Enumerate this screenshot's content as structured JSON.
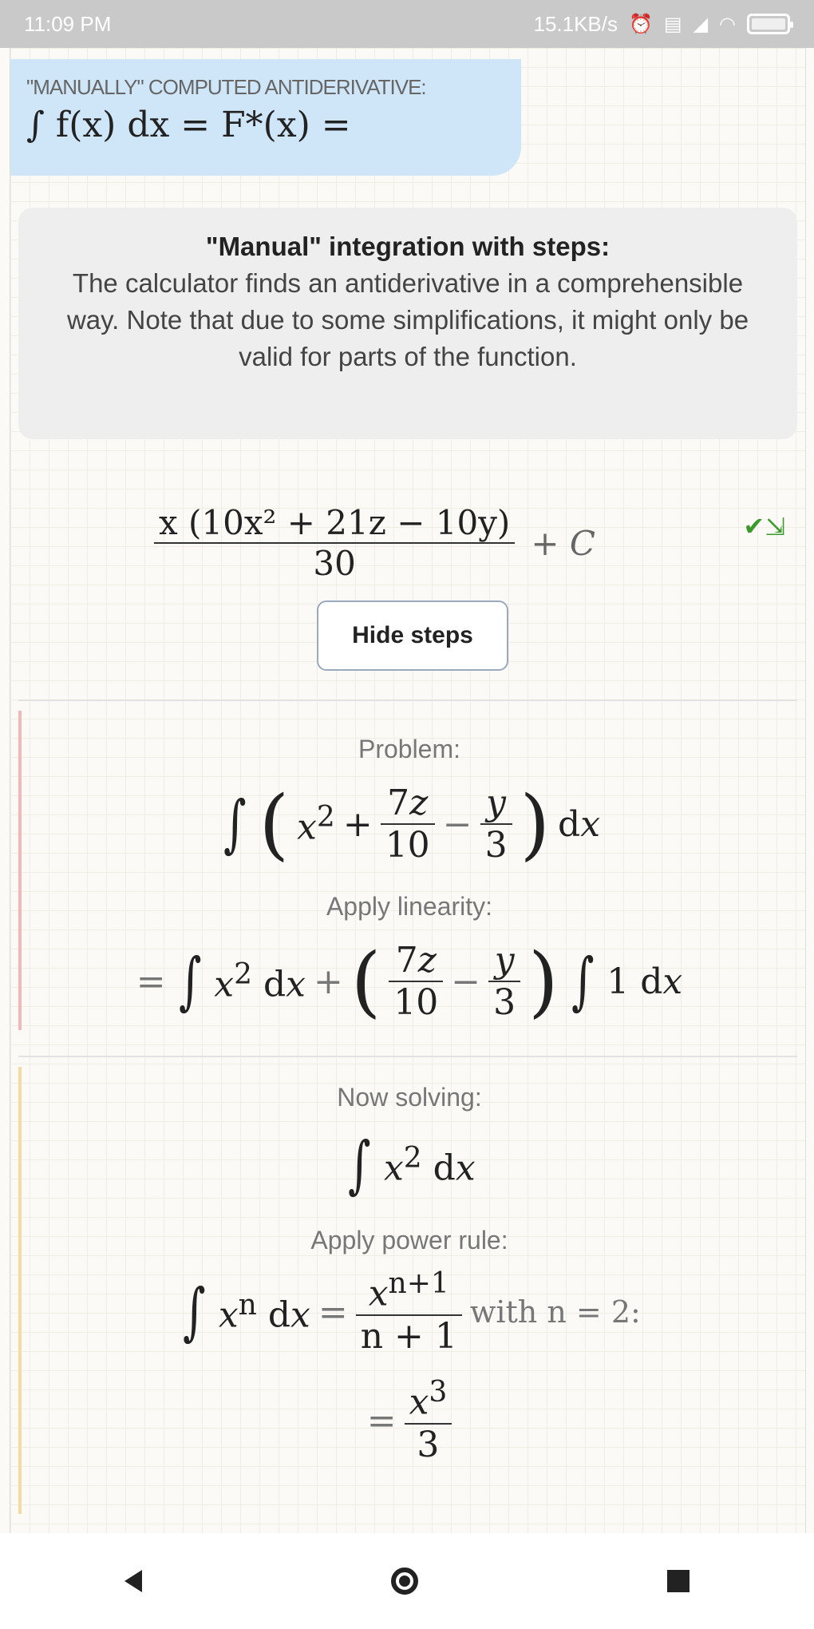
{
  "status_bar": {
    "time": "11:09 PM",
    "network_speed": "15.1KB/s",
    "icons": [
      "alarm-icon",
      "sim-icon",
      "signal-icon",
      "wifi-icon",
      "battery-icon"
    ]
  },
  "header": {
    "caption": "\"MANUALLY\" COMPUTED ANTIDERIVATIVE:",
    "formula": "∫ f(x) dx = F*(x) ="
  },
  "info": {
    "title": "\"Manual\" integration with steps:",
    "text": "The calculator finds an antiderivative in a comprehensible way. Note that due to some simplifications, it might only be valid for parts of the function."
  },
  "result": {
    "numerator": "x (10x² + 21z − 10y)",
    "denominator": "30",
    "constant": "+ C"
  },
  "buttons": {
    "hide_steps": "Hide steps"
  },
  "steps": {
    "problem_label": "Problem:",
    "problem_expr": "∫ (x² + 7z/10 − y/3) dx",
    "linearity_label": "Apply linearity:",
    "linearity_expr": "= ∫x² dx + (7z/10 − y/3) ∫1 dx",
    "now_solving_label": "Now solving:",
    "now_solving_expr": "∫x² dx",
    "power_rule_label": "Apply power rule:",
    "power_rule_expr": "∫xⁿ dx = xⁿ⁺¹/(n+1) with n = 2:",
    "power_rule_result": "= x³/3"
  },
  "colors": {
    "header_bg": "#cfe6f9",
    "info_bg": "#eeeeee",
    "step_red": "#f4b7b7",
    "step_yellow": "#f4dba1"
  }
}
